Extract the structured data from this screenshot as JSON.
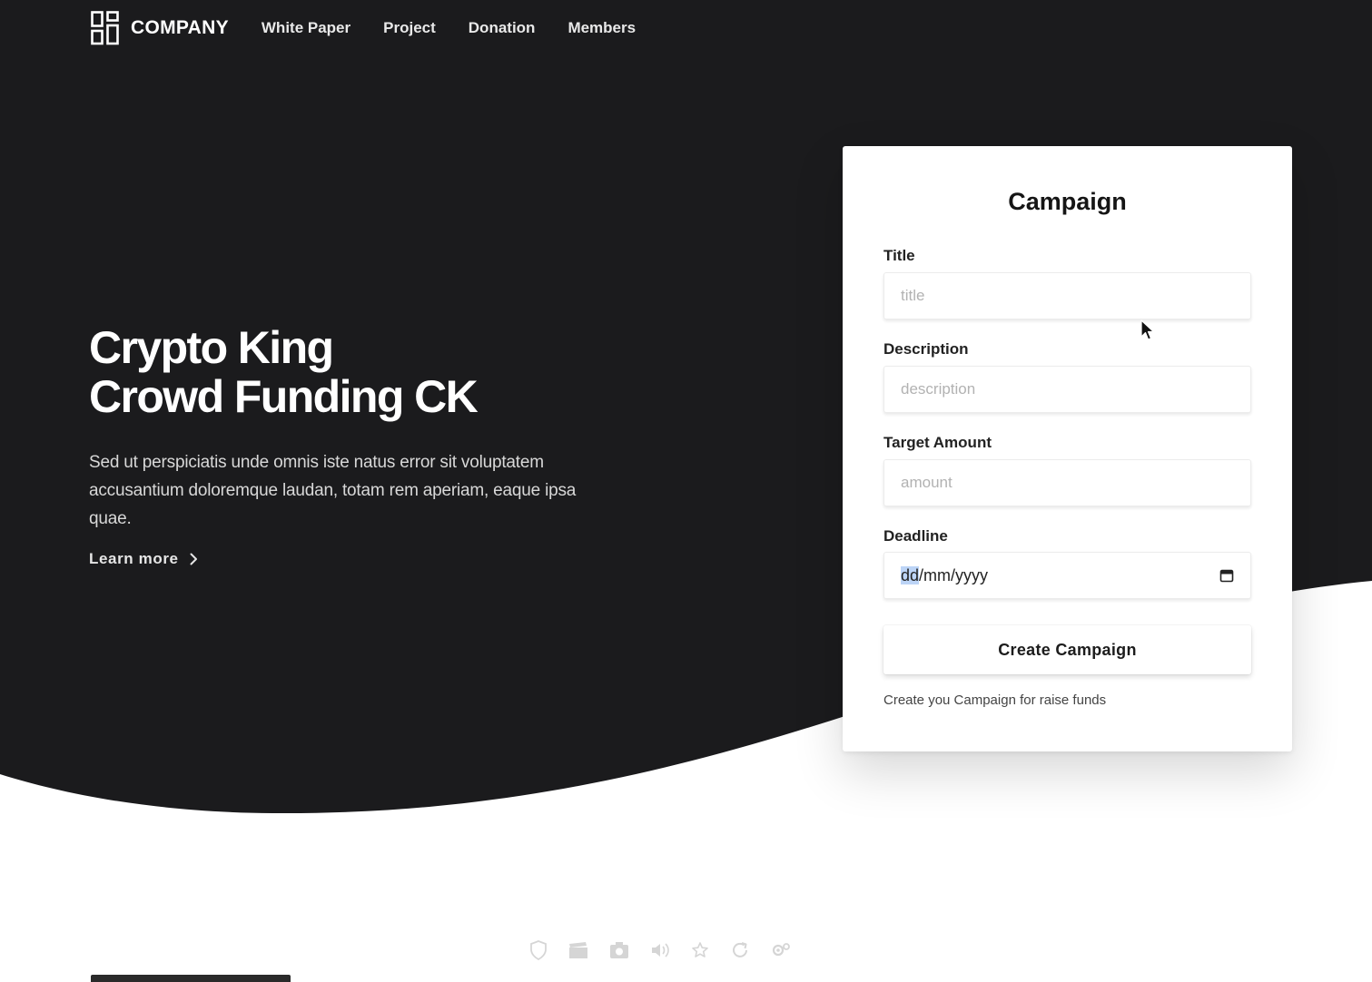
{
  "colors": {
    "hero_background": "#1b1b1d",
    "page_background": "#ffffff",
    "card_background": "#ffffff",
    "accent_text": "#151515"
  },
  "header": {
    "logo_icon": "grid-logo-icon",
    "brand": "COMPANY",
    "nav": [
      {
        "label": "White Paper"
      },
      {
        "label": "Project"
      },
      {
        "label": "Donation"
      },
      {
        "label": "Members"
      }
    ]
  },
  "hero": {
    "title_line1": "Crypto King",
    "title_line2": "Crowd Funding CK",
    "description": "Sed ut perspiciatis unde omnis iste natus error sit voluptatem accusantium doloremque laudan, totam rem aperiam, eaque ipsa quae.",
    "learn_more": "Learn more",
    "learn_more_icon": "chevron-right-icon"
  },
  "campaign_form": {
    "heading": "Campaign",
    "title": {
      "label": "Title",
      "placeholder": "title",
      "value": ""
    },
    "description": {
      "label": "Description",
      "placeholder": "description",
      "value": ""
    },
    "target_amount": {
      "label": "Target Amount",
      "placeholder": "amount",
      "value": ""
    },
    "deadline": {
      "label": "Deadline",
      "day_part": "dd",
      "rest_part": "/mm/yyyy",
      "icon": "calendar-icon"
    },
    "submit_label": "Create Campaign",
    "helper_text": "Create you Campaign for raise funds"
  },
  "player_toolbar": {
    "icons": [
      "shield-icon",
      "clapperboard-icon",
      "camera-icon",
      "volume-icon",
      "pin-icon",
      "refresh-icon",
      "settings-icon"
    ]
  }
}
